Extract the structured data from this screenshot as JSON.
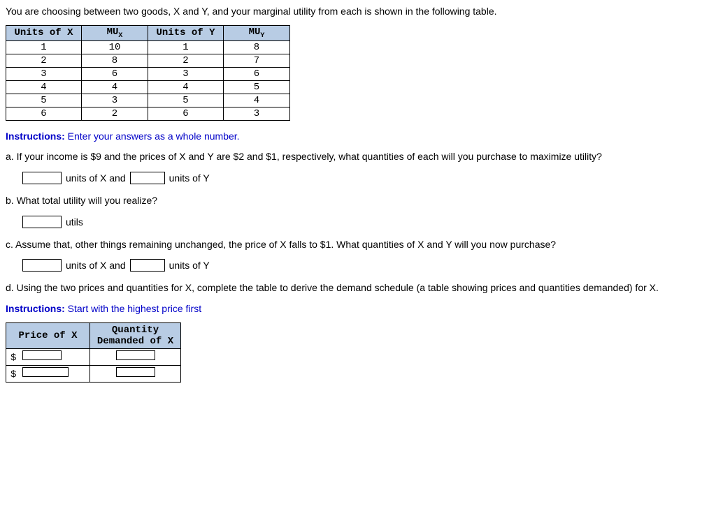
{
  "intro": "You are choosing between two goods, X and Y, and your marginal utility from each is shown in the following table.",
  "mu_table": {
    "headers": {
      "ux": "Units of X",
      "mux": "MU",
      "mux_sub": "X",
      "uy": "Units of Y",
      "muy": "MU",
      "muy_sub": "Y"
    },
    "rows": [
      {
        "ux": "1",
        "mux": "10",
        "uy": "1",
        "muy": "8"
      },
      {
        "ux": "2",
        "mux": "8",
        "uy": "2",
        "muy": "7"
      },
      {
        "ux": "3",
        "mux": "6",
        "uy": "3",
        "muy": "6"
      },
      {
        "ux": "4",
        "mux": "4",
        "uy": "4",
        "muy": "5"
      },
      {
        "ux": "5",
        "mux": "3",
        "uy": "5",
        "muy": "4"
      },
      {
        "ux": "6",
        "mux": "2",
        "uy": "6",
        "muy": "3"
      }
    ]
  },
  "instructions1": {
    "label": "Instructions:",
    "text": " Enter your answers as a whole number."
  },
  "qa": {
    "text": "a. If your income is $9 and the prices of X and Y are $2 and $1, respectively, what quantities of each will you purchase to maximize utility?",
    "ans_mid": "units of X and",
    "ans_end": "units of Y"
  },
  "qb": {
    "text": "b. What total utility will you realize?",
    "ans_end": "utils"
  },
  "qc": {
    "text": "c. Assume that, other things remaining unchanged, the price of X falls to $1. What quantities of X and Y will you now purchase?",
    "ans_mid": "units of X and",
    "ans_end": "units of Y"
  },
  "qd": {
    "text": "d. Using the two prices and quantities for X, complete the table to derive the demand schedule (a table showing prices and quantities demanded) for X."
  },
  "instructions2": {
    "label": "Instructions:",
    "text": " Start with the highest price first"
  },
  "demand_table": {
    "headers": {
      "price": "Price of X",
      "qty_l1": "Quantity",
      "qty_l2": "Demanded of X"
    },
    "dollar": "$"
  }
}
